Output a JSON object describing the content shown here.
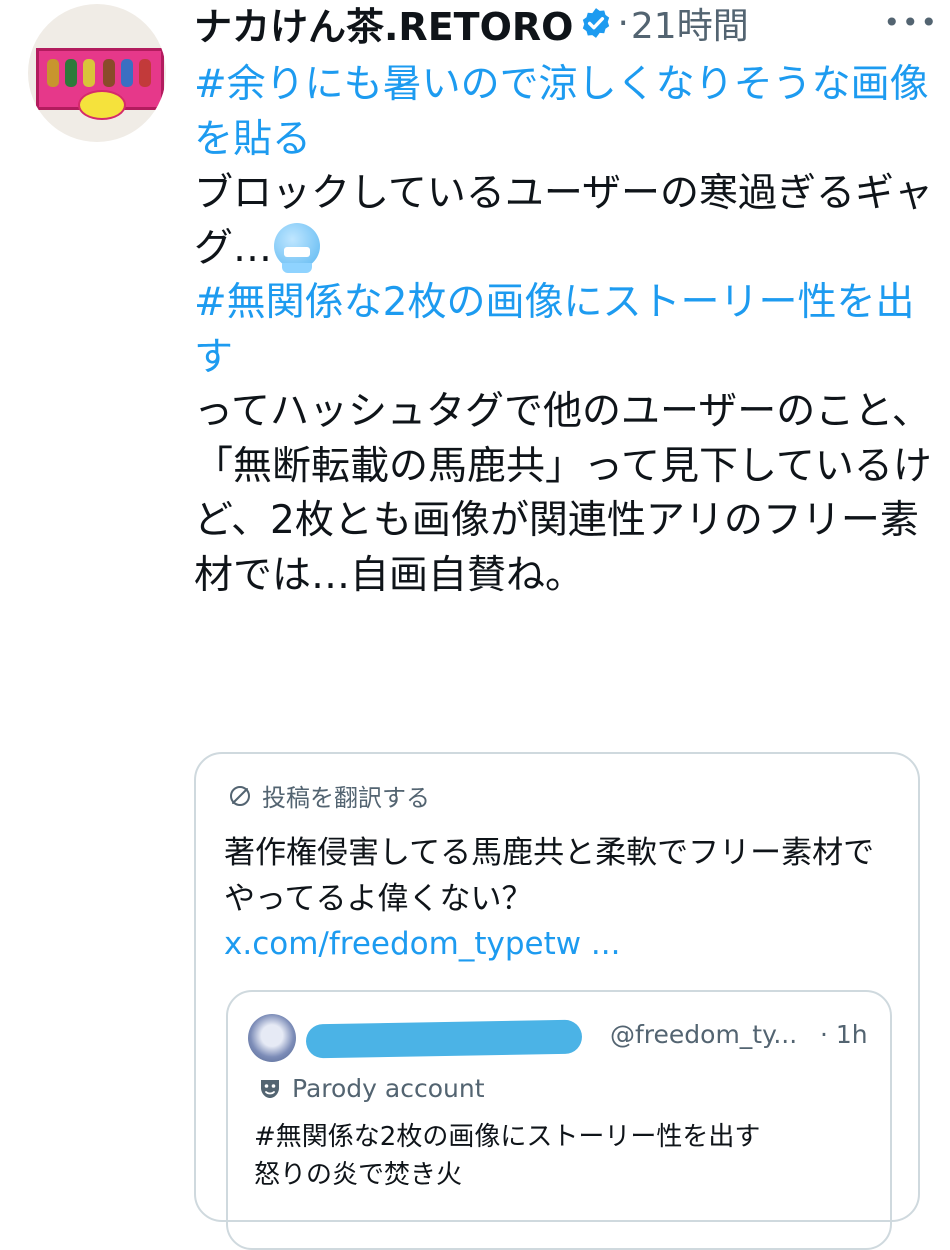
{
  "author": {
    "display_name": "ナカけん茶.RETORO",
    "verified": true,
    "separator": "·",
    "time_ago": "21時間",
    "more_label": "•••"
  },
  "tweet": {
    "hashtag_1": "#余りにも暑いので涼しくなりそうな画像を貼る",
    "text_1": "ブロックしているユーザーの寒過ぎるギャグ…",
    "emoji": "cold-face-emoji",
    "hashtag_2": "#無関係な2枚の画像にストーリー性を出す",
    "text_2": "ってハッシュタグで他のユーザーのこと、「無断転載の馬鹿共」って見下しているけど、2枚とも画像が関連性アリのフリー素材では…自画自賛ね。"
  },
  "quote": {
    "translate_label": "投稿を翻訳する",
    "text": "著作権侵害してる馬鹿共と柔軟でフリー素材でやってるよ偉くない？",
    "link": "x.com/freedom_typetw ...",
    "inner": {
      "handle": "@freedom_ty...",
      "time": "· 1h",
      "label": "Parody account",
      "line_1": "#無関係な2枚の画像にストーリー性を出す",
      "line_2": "怒りの炎で焚き火"
    }
  },
  "colors": {
    "link": "#1d9bf0",
    "secondary": "#536471",
    "border": "#cfd9de",
    "redaction": "#4bb3e6"
  }
}
